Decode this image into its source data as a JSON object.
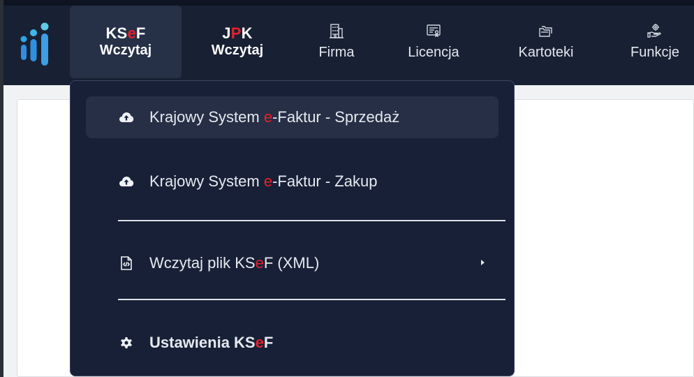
{
  "nav": {
    "ksef": {
      "title_a": "KS",
      "title_b": "e",
      "title_c": "F",
      "sub": "Wczytaj"
    },
    "jpk": {
      "title_a": "J",
      "title_b": "P",
      "title_c": "K",
      "sub": "Wczytaj"
    },
    "firma": {
      "label": "Firma",
      "icon": "building-icon"
    },
    "licencja": {
      "label": "Licencja",
      "icon": "certificate-icon"
    },
    "kartoteki": {
      "label": "Kartoteki",
      "icon": "folders-icon"
    },
    "funkcje": {
      "label": "Funkcje",
      "icon": "hand-gear-icon"
    }
  },
  "menu": {
    "item1": {
      "a": "Krajowy System ",
      "b": "e",
      "c": "-Faktur - Sprzedaż",
      "icon": "cloud-upload-icon"
    },
    "item2": {
      "a": "Krajowy System ",
      "b": "e",
      "c": "-Faktur - Zakup",
      "icon": "cloud-upload-icon"
    },
    "item3": {
      "a": "Wczytaj plik KS",
      "b": "e",
      "c": "F (XML)",
      "icon": "file-code-icon"
    },
    "item4": {
      "a": "Ustawienia KS",
      "b": "e",
      "c": "F",
      "icon": "gear-icon"
    }
  },
  "colors": {
    "accent_red": "#e8202a",
    "nav_bg": "#182033",
    "menu_bg": "#172036",
    "hover_bg": "#262f45"
  }
}
